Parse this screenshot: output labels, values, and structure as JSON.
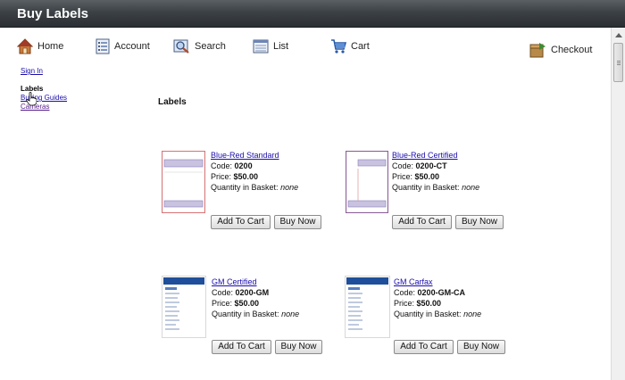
{
  "window": {
    "title": "Buy Labels"
  },
  "nav": {
    "home": "Home",
    "account": "Account",
    "search": "Search",
    "list": "List",
    "cart": "Cart",
    "checkout": "Checkout"
  },
  "sidebar": {
    "sign_in": "Sign In",
    "labels_heading": "Labels",
    "buying_guides": "Buying Guides",
    "cameras": "Cameras"
  },
  "main": {
    "section_title": "Labels"
  },
  "labels": {
    "code": "Code:",
    "price": "Price:",
    "quantity": "Quantity in Basket:",
    "add_to_cart": "Add To Cart",
    "buy_now": "Buy Now"
  },
  "products": [
    {
      "name": "Blue-Red Standard",
      "code": "0200",
      "price": "$50.00",
      "quantity": "none"
    },
    {
      "name": "Blue-Red Certified",
      "code": "0200-CT",
      "price": "$50.00",
      "quantity": "none"
    },
    {
      "name": "GM Certified",
      "code": "0200-GM",
      "price": "$50.00",
      "quantity": "none"
    },
    {
      "name": "GM Carfax",
      "code": "0200-GM-CA",
      "price": "$50.00",
      "quantity": "none"
    }
  ],
  "colors": {
    "titlebar": "#3c4145",
    "link": "#1a0dab",
    "visited_link": "#551a8b"
  }
}
